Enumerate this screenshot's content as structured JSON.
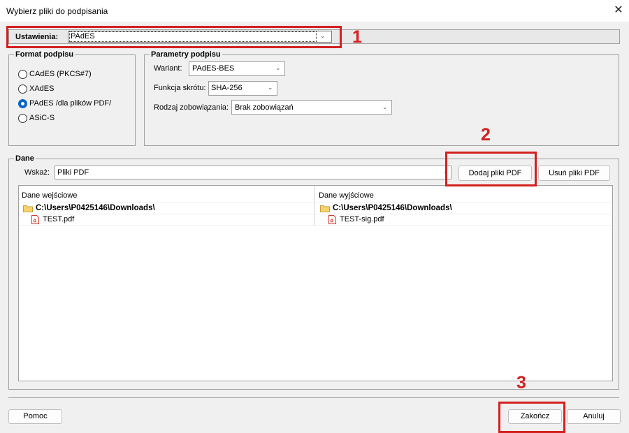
{
  "window": {
    "title": "Wybierz pliki do podpisania",
    "close_glyph": "✕"
  },
  "settings": {
    "label": "Ustawienia:",
    "value": "PAdES"
  },
  "format": {
    "title": "Format podpisu",
    "options": [
      {
        "label": "CAdES (PKCS#7)",
        "checked": false
      },
      {
        "label": "XAdES",
        "checked": false
      },
      {
        "label": "PAdES /dla plików PDF/",
        "checked": true
      },
      {
        "label": "ASiC-S",
        "checked": false
      }
    ]
  },
  "params": {
    "title": "Parametry podpisu",
    "variant_label": "Wariant:",
    "variant_value": "PAdES-BES",
    "hash_label": "Funkcja skrótu:",
    "hash_value": "SHA-256",
    "commitment_label": "Rodzaj zobowiązania:",
    "commitment_value": "Brak zobowiązań"
  },
  "data": {
    "title": "Dane",
    "filter_label": "Wskaż:",
    "filter_value": "Pliki PDF",
    "add_button": "Dodaj pliki PDF",
    "remove_button": "Usuń pliki PDF",
    "columns": [
      "Dane wejściowe",
      "Dane wyjściowe"
    ],
    "input": {
      "folder": "C:\\Users\\P0425146\\Downloads\\",
      "file": "TEST.pdf"
    },
    "output": {
      "folder": "C:\\Users\\P0425146\\Downloads\\",
      "file": "TEST-sig.pdf"
    }
  },
  "footer": {
    "help_button": "Pomoc",
    "finish_button": "Zakończ",
    "cancel_button": "Anuluj"
  },
  "annotations": {
    "n1": "1",
    "n2": "2",
    "n3": "3",
    "color": "#d42020"
  }
}
